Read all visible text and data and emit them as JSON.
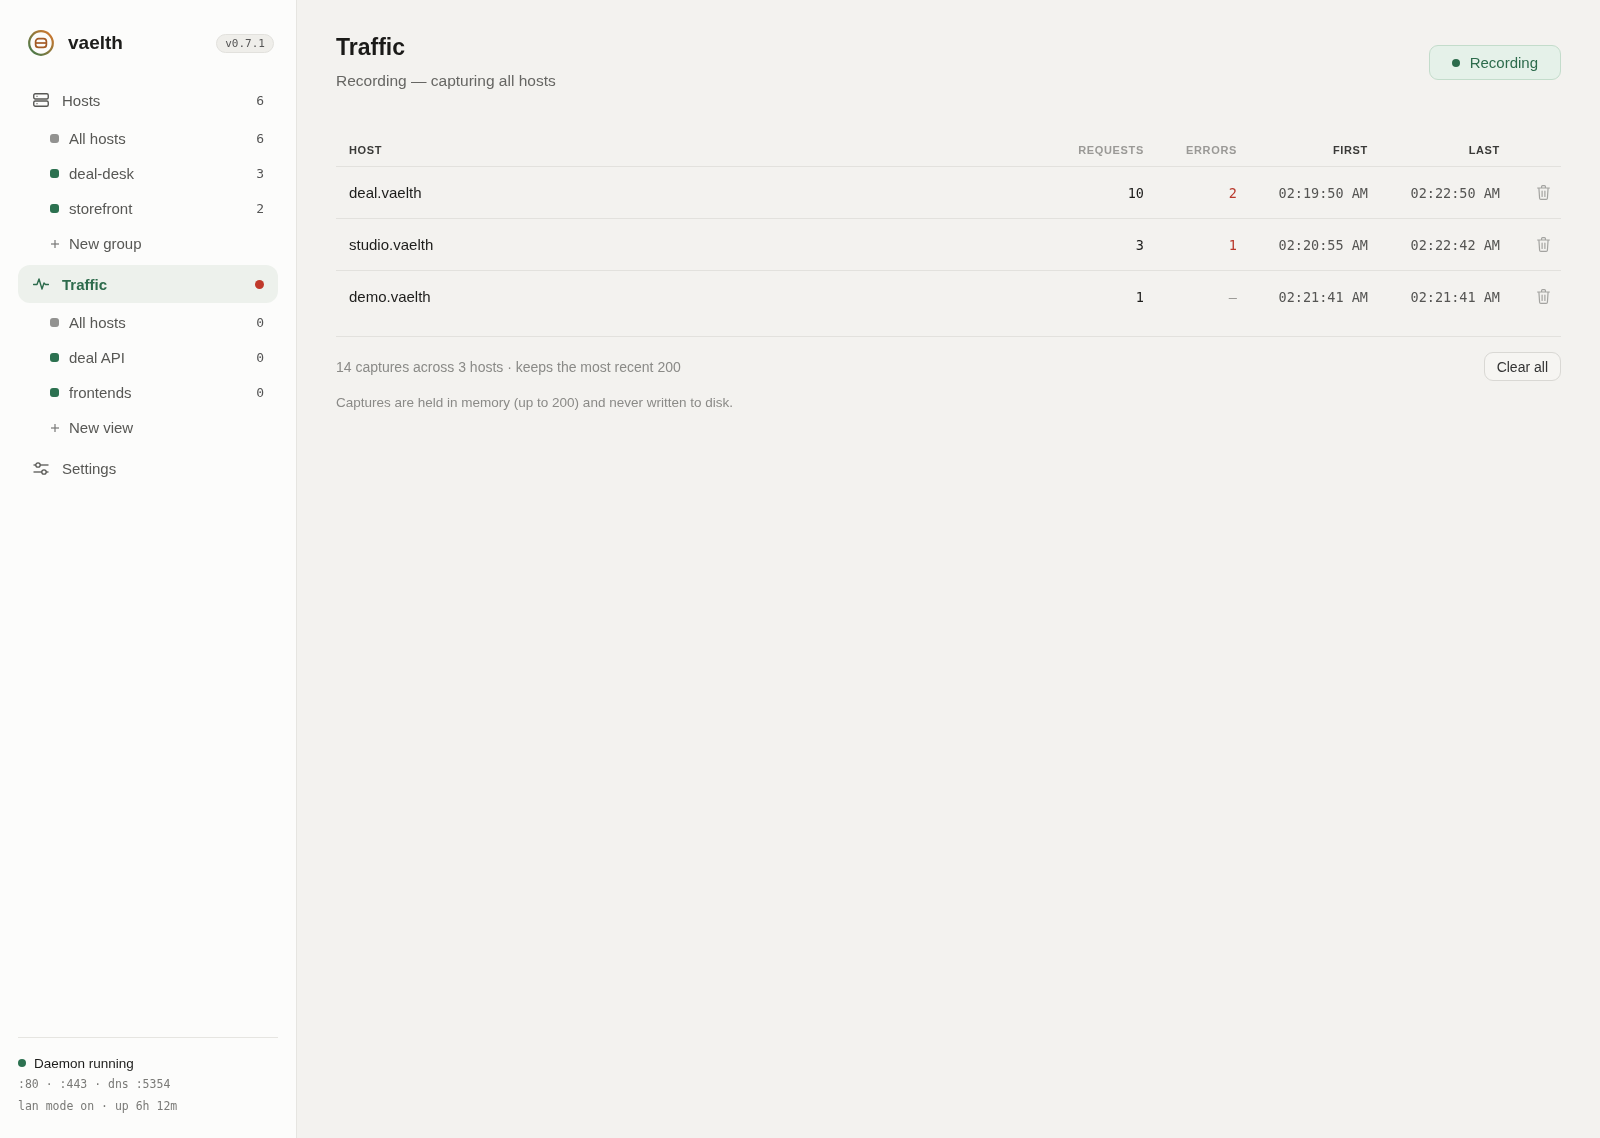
{
  "brand": {
    "name": "vaelth",
    "version": "v0.7.1"
  },
  "sidebar": {
    "sections": [
      {
        "label": "Hosts",
        "count": "6",
        "selected": false,
        "children": [
          {
            "kind": "filter",
            "label": "All hosts",
            "count": "6",
            "color": "#929290",
            "selected": false
          },
          {
            "kind": "filter",
            "label": "deal-desk",
            "count": "3",
            "color": "#2c7150",
            "selected": false
          },
          {
            "kind": "filter",
            "label": "storefront",
            "count": "2",
            "color": "#2c7150",
            "selected": false
          },
          {
            "kind": "add",
            "label": "New group"
          }
        ]
      },
      {
        "label": "Traffic",
        "selected": true,
        "live": true,
        "children": [
          {
            "kind": "filter",
            "label": "All hosts",
            "count": "0",
            "color": "#929290",
            "selected": false
          },
          {
            "kind": "filter",
            "label": "deal API",
            "count": "0",
            "color": "#2c7150",
            "selected": false
          },
          {
            "kind": "filter",
            "label": "frontends",
            "count": "0",
            "color": "#2c7150",
            "selected": false
          },
          {
            "kind": "add",
            "label": "New view"
          }
        ]
      },
      {
        "label": "Settings",
        "selected": false
      }
    ]
  },
  "daemon": {
    "label": "Daemon running",
    "running": true,
    "lines": [
      ":80 · :443 · dns :5354",
      "lan mode on · up 6h 12m"
    ]
  },
  "page": {
    "title": "Traffic",
    "subtitle": "Recording — capturing all hosts",
    "record_button": {
      "label": "Recording",
      "on": true
    }
  },
  "table": {
    "columns": [
      {
        "label": "HOST",
        "dim": false
      },
      {
        "label": "REQUESTS",
        "dim": true
      },
      {
        "label": "ERRORS",
        "dim": true
      },
      {
        "label": "FIRST",
        "dim": false
      },
      {
        "label": "LAST",
        "dim": false
      }
    ],
    "rows": [
      {
        "host": "deal.vaelth",
        "requests": "10",
        "errors": "2",
        "has_errors": true,
        "first": "02:19:50 AM",
        "last": "02:22:50 AM"
      },
      {
        "host": "studio.vaelth",
        "requests": "3",
        "errors": "1",
        "has_errors": true,
        "first": "02:20:55 AM",
        "last": "02:22:42 AM"
      },
      {
        "host": "demo.vaelth",
        "requests": "1",
        "errors": "—",
        "has_errors": false,
        "first": "02:21:41 AM",
        "last": "02:21:41 AM"
      }
    ]
  },
  "footer": {
    "summary": "14 captures across 3 hosts · keeps the most recent 200",
    "clear_button": "Clear all",
    "note": "Captures are held in memory (up to 200) and never written to disk."
  }
}
